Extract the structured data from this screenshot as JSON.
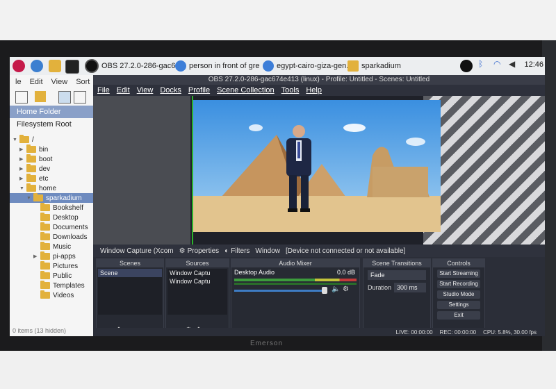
{
  "taskbar": {
    "tasks": [
      {
        "label": "OBS 27.2.0-286-gac6..."
      },
      {
        "label": "person in front of gre..."
      },
      {
        "label": "egypt-cairo-giza-gen..."
      },
      {
        "label": "sparkadium"
      }
    ],
    "clock": "12:46",
    "icons": [
      "raspberry-icon",
      "globe-icon",
      "folder-icon",
      "terminal-icon",
      "obs-icon",
      "bluetooth-icon",
      "wifi-icon",
      "volume-icon"
    ]
  },
  "file_manager": {
    "menu": [
      "le",
      "Edit",
      "View",
      "Sort"
    ],
    "places": [
      {
        "label": "Home Folder",
        "selected": true
      },
      {
        "label": "Filesystem Root",
        "selected": false
      }
    ],
    "tree": [
      {
        "label": "/",
        "indent": 0,
        "arrow": "▼"
      },
      {
        "label": "bin",
        "indent": 1,
        "arrow": "▶"
      },
      {
        "label": "boot",
        "indent": 1,
        "arrow": "▶"
      },
      {
        "label": "dev",
        "indent": 1,
        "arrow": "▶"
      },
      {
        "label": "etc",
        "indent": 1,
        "arrow": "▶"
      },
      {
        "label": "home",
        "indent": 1,
        "arrow": "▼"
      },
      {
        "label": "sparkadium",
        "indent": 2,
        "arrow": "▼",
        "selected": true
      },
      {
        "label": "Bookshelf",
        "indent": 3,
        "arrow": ""
      },
      {
        "label": "Desktop",
        "indent": 3,
        "arrow": ""
      },
      {
        "label": "Documents",
        "indent": 3,
        "arrow": ""
      },
      {
        "label": "Downloads",
        "indent": 3,
        "arrow": ""
      },
      {
        "label": "Music",
        "indent": 3,
        "arrow": ""
      },
      {
        "label": "pi-apps",
        "indent": 3,
        "arrow": "▶"
      },
      {
        "label": "Pictures",
        "indent": 3,
        "arrow": ""
      },
      {
        "label": "Public",
        "indent": 3,
        "arrow": ""
      },
      {
        "label": "Templates",
        "indent": 3,
        "arrow": ""
      },
      {
        "label": "Videos",
        "indent": 3,
        "arrow": ""
      }
    ],
    "status": "0 items (13 hidden)"
  },
  "obs": {
    "title": "OBS 27.2.0-286-gac674e413 (linux) - Profile: Untitled - Scenes: Untitled",
    "menu": [
      "File",
      "Edit",
      "View",
      "Docks",
      "Profile",
      "Scene Collection",
      "Tools",
      "Help"
    ],
    "source_bar": {
      "source": "Window Capture (Xcom",
      "properties": "Properties",
      "filters": "Filters",
      "window": "Window",
      "device_status": "[Device not connected or not available]"
    },
    "scenes": {
      "header": "Scenes",
      "items": [
        "Scene"
      ]
    },
    "sources": {
      "header": "Sources",
      "items": [
        "Window Captu",
        "Window Captu"
      ]
    },
    "mixer": {
      "header": "Audio Mixer",
      "channel": "Desktop Audio",
      "level": "0.0 dB"
    },
    "transitions": {
      "header": "Scene Transitions",
      "type": "Fade",
      "duration_label": "Duration",
      "duration": "300 ms"
    },
    "controls": {
      "header": "Controls",
      "buttons": [
        "Start Streaming",
        "Start Recording",
        "Studio Mode",
        "Settings",
        "Exit"
      ]
    },
    "status": {
      "live": "LIVE: 00:00:00",
      "rec": "REC: 00:00:00",
      "cpu": "CPU: 5.8%, 30.00 fps"
    }
  },
  "monitor": {
    "brand": "Emerson"
  }
}
